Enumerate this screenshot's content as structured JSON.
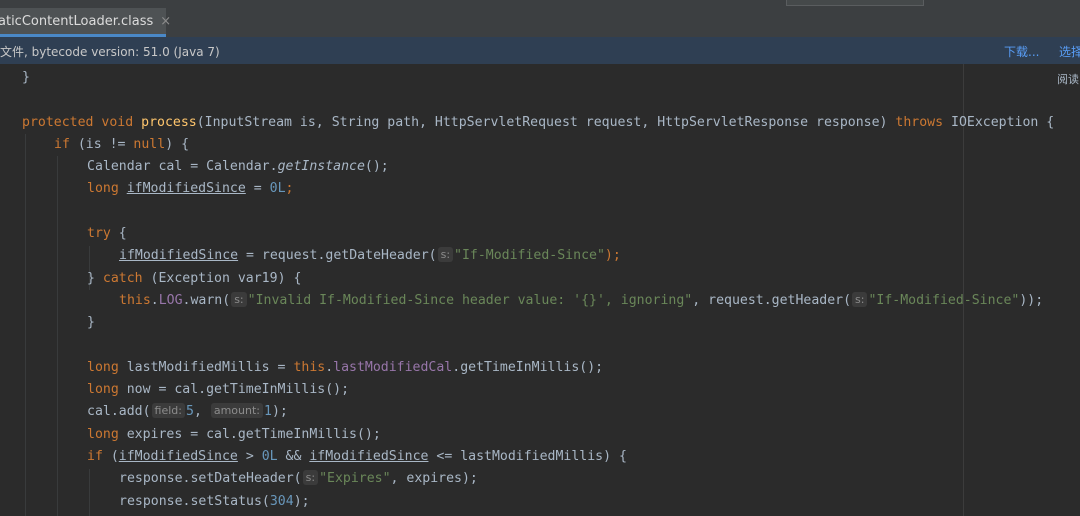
{
  "tab": {
    "label": "aticContentLoader.class",
    "close": "×"
  },
  "banner": {
    "text": "文件, bytecode version: 51.0 (Java 7)",
    "download": "下载...",
    "choose": "选择"
  },
  "editor": {
    "reader_mode": "阅读"
  },
  "code": {
    "l1": "}",
    "l2": {
      "kw1": "protected",
      "kw2": "void",
      "name": "process",
      "params": "(InputStream is, String path, HttpServletRequest request, HttpServletResponse response) ",
      "throws": "throws",
      "exc": "IOException {"
    },
    "l3": {
      "kw": "if",
      "a": " (is != ",
      "null": "null",
      "b": ") {"
    },
    "l4": {
      "a": "Calendar cal = Calendar.",
      "m": "getInstance",
      "b": "();"
    },
    "l5": {
      "kw": "long",
      "var": "ifModifiedSince",
      "a": " = ",
      "num": "0L",
      "b": ";"
    },
    "l6": {
      "kw": "try",
      "a": " {"
    },
    "l7": {
      "var": "ifModifiedSince",
      "a": " = request.getDateHeader(",
      "hint": "s:",
      "str": "\"If-Modified-Since\"",
      "b": ");"
    },
    "l8": {
      "a": "} ",
      "kw": "catch",
      "b": " (Exception var19) {"
    },
    "l9": {
      "kw": "this",
      "dot": ".",
      "f": "LOG",
      "a": ".warn(",
      "hint1": "s:",
      "str1": "\"Invalid If-Modified-Since header value: '{}', ignoring\"",
      "b": ", request.getHeader(",
      "hint2": "s:",
      "str2": "\"If-Modified-Since\"",
      "c": "));"
    },
    "l10": "}",
    "l11": {
      "kw": "long",
      "a": " lastModifiedMillis = ",
      "kw2": "this",
      "dot": ".",
      "f": "lastModifiedCal",
      "b": ".getTimeInMillis();"
    },
    "l12": {
      "kw": "long",
      "a": " now = cal.getTimeInMillis();"
    },
    "l13": {
      "a": "cal.add(",
      "hint1": "field:",
      "num1": "5",
      "comma": ", ",
      "hint2": "amount:",
      "num2": "1",
      "b": ");"
    },
    "l14": {
      "kw": "long",
      "a": " expires = cal.getTimeInMillis();"
    },
    "l15": {
      "kw": "if",
      "a": " (",
      "var1": "ifModifiedSince",
      "b": " > ",
      "num": "0L",
      "c": " && ",
      "var2": "ifModifiedSince",
      "d": " <= lastModifiedMillis) {"
    },
    "l16": {
      "a": "response.setDateHeader(",
      "hint": "s:",
      "str": "\"Expires\"",
      "b": ", expires);"
    },
    "l17": {
      "a": "response.setStatus(",
      "num": "304",
      "b": ");"
    }
  }
}
